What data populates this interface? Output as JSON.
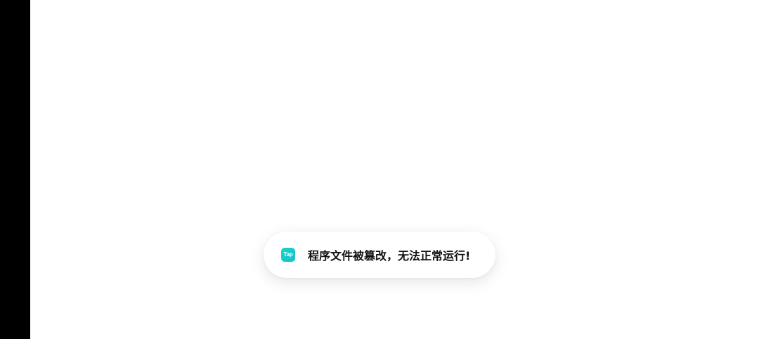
{
  "toast": {
    "icon": "taptap-app-icon",
    "icon_text": "Tap",
    "message": "程序文件被篡改，无法正常运行!"
  },
  "colors": {
    "left_bar": "#000000",
    "background": "#ffffff",
    "toast_background": "#ffffff",
    "icon_accent": "#19d3c5",
    "message_text": "#111111"
  }
}
